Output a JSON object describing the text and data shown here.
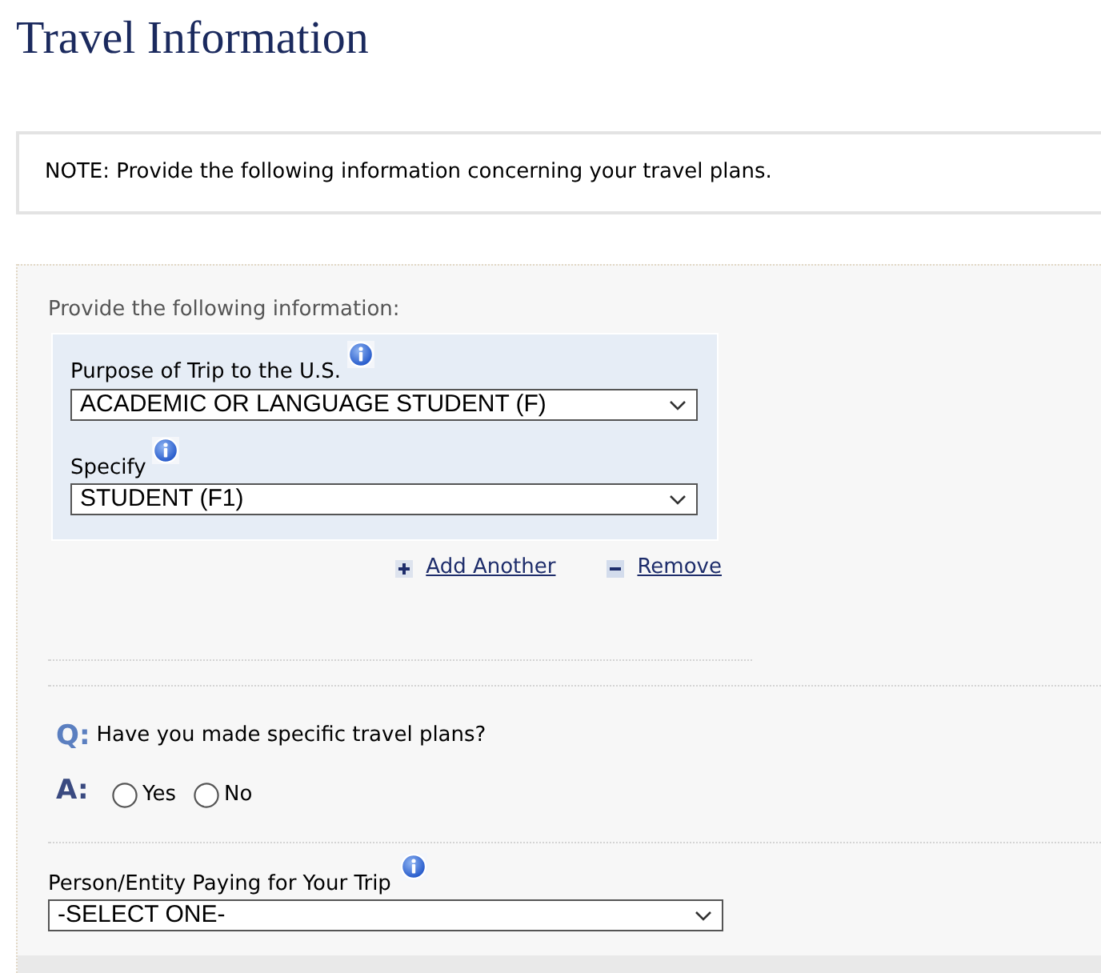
{
  "page_title": "Travel Information",
  "note": "NOTE: Provide the following information concerning your travel plans.",
  "form": {
    "instruction": "Provide the following information:",
    "purpose_fields": [
      {
        "label": "Purpose of Trip to the U.S.",
        "value": "ACADEMIC OR LANGUAGE STUDENT (F)"
      },
      {
        "label": "Specify",
        "value": "STUDENT (F1)"
      }
    ],
    "links": [
      {
        "kind": "add",
        "label": "Add Another"
      },
      {
        "kind": "remove",
        "label": "Remove"
      }
    ],
    "question": {
      "q_marker": "Q:",
      "text": "Have you made specific travel plans?",
      "a_marker": "A:",
      "options": [
        {
          "label": "Yes",
          "selected": false
        },
        {
          "label": "No",
          "selected": false
        }
      ]
    },
    "payer": {
      "label": "Person/Entity Paying for Your Trip",
      "value": "-SELECT ONE-"
    }
  }
}
